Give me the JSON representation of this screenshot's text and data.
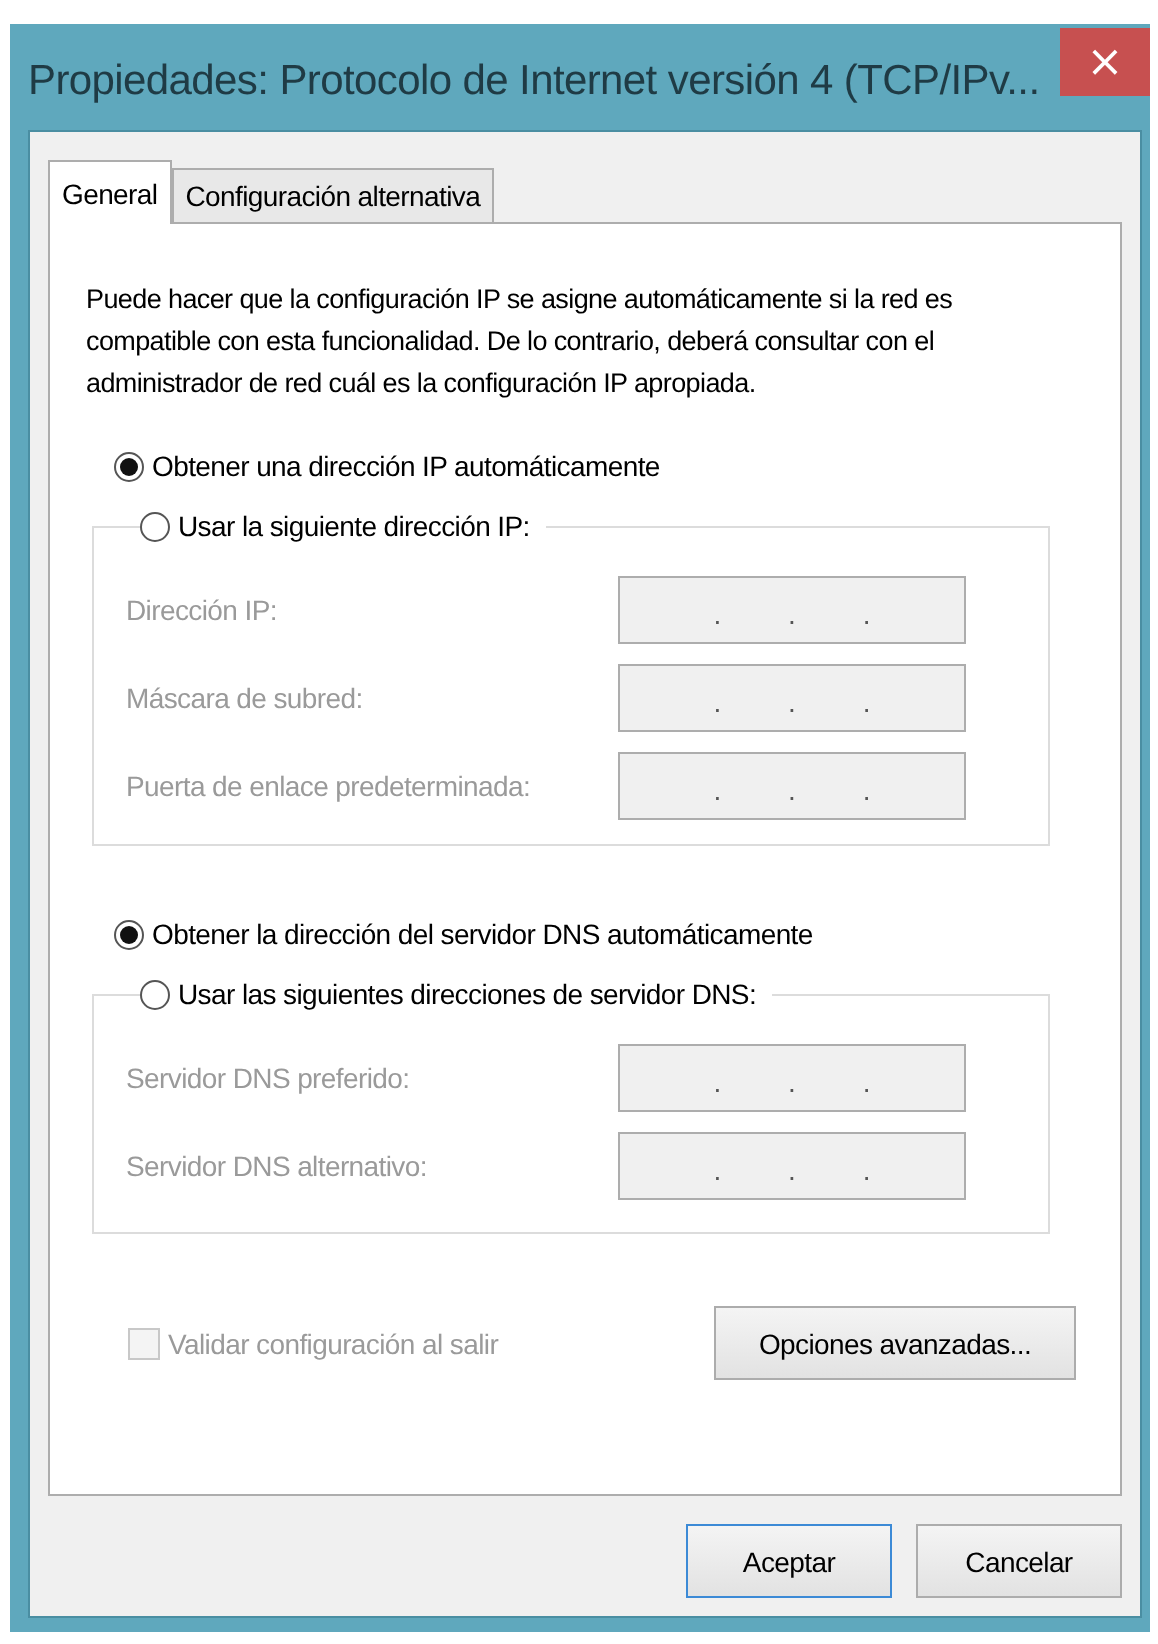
{
  "window": {
    "title": "Propiedades: Protocolo de Internet versión 4 (TCP/IPv...",
    "close_label": "×"
  },
  "tabs": [
    {
      "label": "General",
      "selected": true
    },
    {
      "label": "Configuración alternativa",
      "selected": false
    }
  ],
  "description": "Puede hacer que la configuración IP se asigne automáticamente si la red es compatible con esta funcionalidad. De lo contrario, deberá consultar con el administrador de red cuál es la configuración IP apropiada.",
  "ip_section": {
    "options": [
      {
        "label": "Obtener una dirección IP automáticamente",
        "selected": true
      },
      {
        "label": "Usar la siguiente dirección IP:",
        "selected": false
      }
    ],
    "fields": [
      {
        "label": "Dirección IP:",
        "disabled": true,
        "separators": [
          ".",
          ".",
          "."
        ]
      },
      {
        "label": "Máscara de subred:",
        "disabled": true,
        "separators": [
          ".",
          ".",
          "."
        ]
      },
      {
        "label": "Puerta de enlace predeterminada:",
        "disabled": true,
        "separators": [
          ".",
          ".",
          "."
        ]
      }
    ]
  },
  "dns_section": {
    "options": [
      {
        "label": "Obtener la dirección del servidor DNS automáticamente",
        "selected": true
      },
      {
        "label": "Usar las siguientes direcciones de servidor DNS:",
        "selected": false
      }
    ],
    "fields": [
      {
        "label": "Servidor DNS preferido:",
        "disabled": true,
        "separators": [
          ".",
          ".",
          "."
        ]
      },
      {
        "label": "Servidor DNS alternativo:",
        "disabled": true,
        "separators": [
          ".",
          ".",
          "."
        ]
      }
    ]
  },
  "validate_checkbox": {
    "label": "Validar configuración al salir",
    "checked": false,
    "disabled": true
  },
  "advanced_button": {
    "label": "Opciones avanzadas..."
  },
  "buttons": [
    {
      "label": "Aceptar",
      "default": true
    },
    {
      "label": "Cancelar",
      "default": false
    }
  ]
}
